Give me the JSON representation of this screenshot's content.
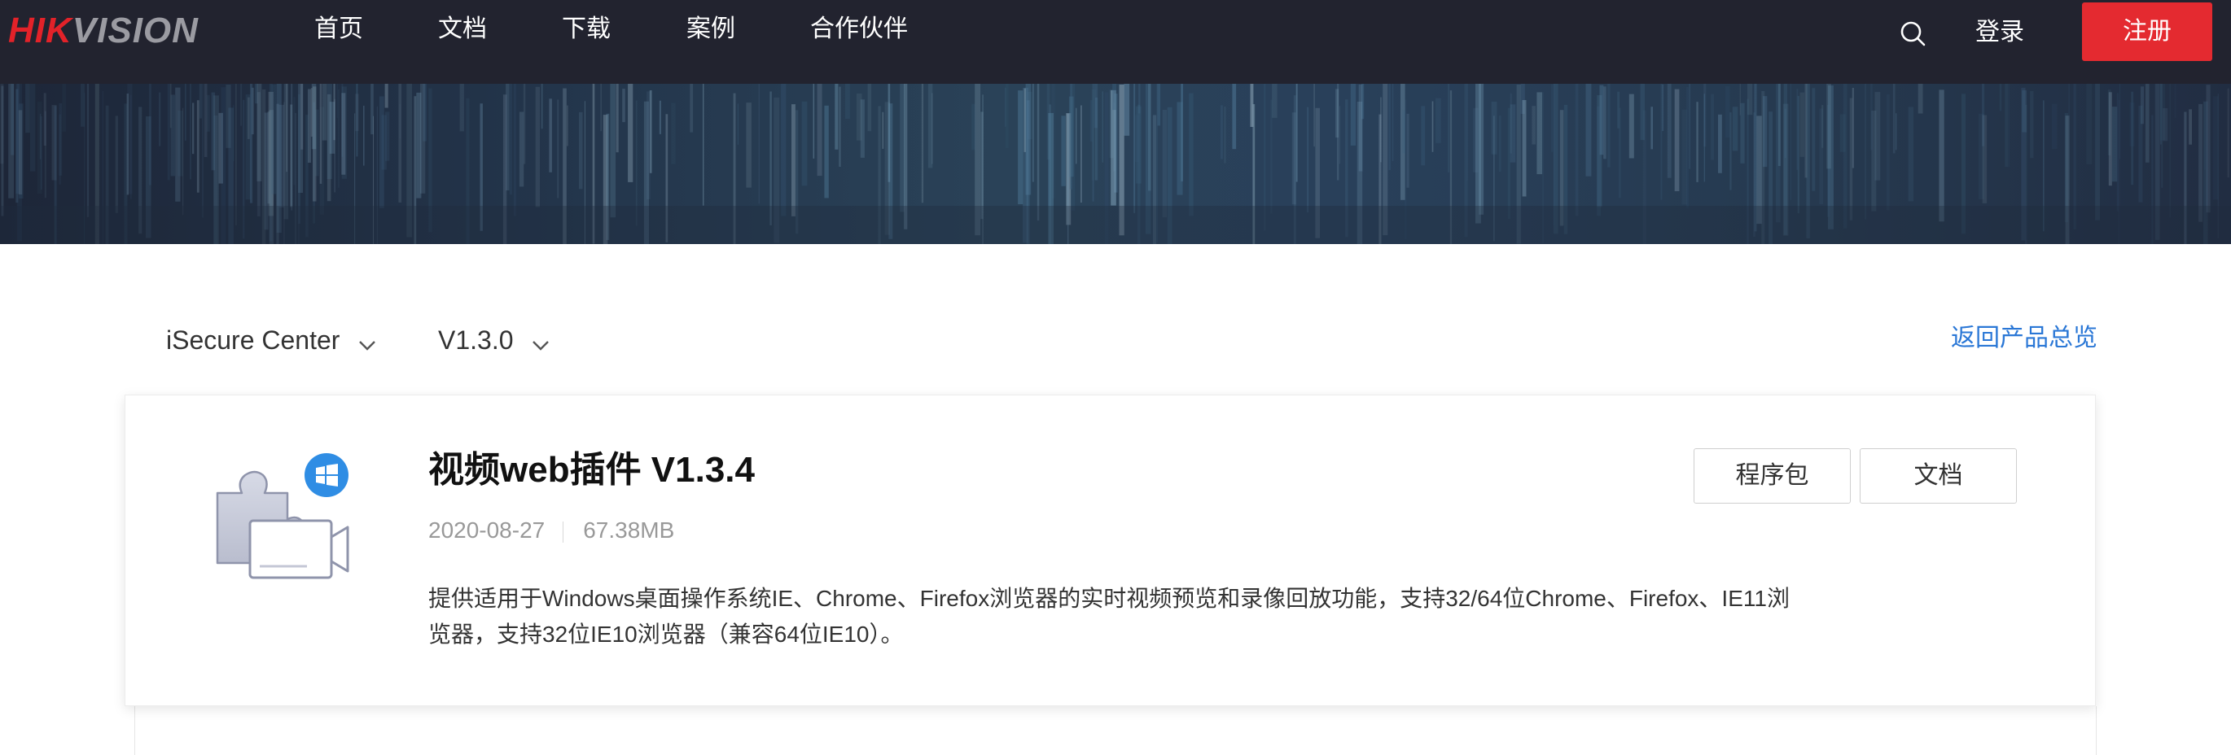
{
  "brand": {
    "logo_hik": "HIK",
    "logo_vision": "VISION",
    "colors": {
      "hik": "#e32229",
      "vision": "#9b9ba2"
    }
  },
  "nav": {
    "items": [
      {
        "label": "首页"
      },
      {
        "label": "文档"
      },
      {
        "label": "下载"
      },
      {
        "label": "案例"
      },
      {
        "label": "合作伙伴"
      }
    ],
    "search_icon": "search-icon",
    "login_label": "登录",
    "register_label": "注册",
    "register_color": "#e42a30",
    "background": "#22232f"
  },
  "filters": {
    "product": "iSecure Center",
    "version": "V1.3.0",
    "back_link": "返回产品总览",
    "link_color": "#2a77d6"
  },
  "card": {
    "icon": "video-plugin-windows-icon",
    "title": "视频web插件 V1.3.4",
    "date": "2020-08-27",
    "size": "67.38MB",
    "description": "提供适用于Windows桌面操作系统IE、Chrome、Firefox浏览器的实时视频预览和录像回放功能，支持32/64位Chrome、Firefox、IE11浏览器，支持32位IE10浏览器（兼容64位IE10）。",
    "buttons": {
      "package": "程序包",
      "docs": "文档"
    }
  }
}
